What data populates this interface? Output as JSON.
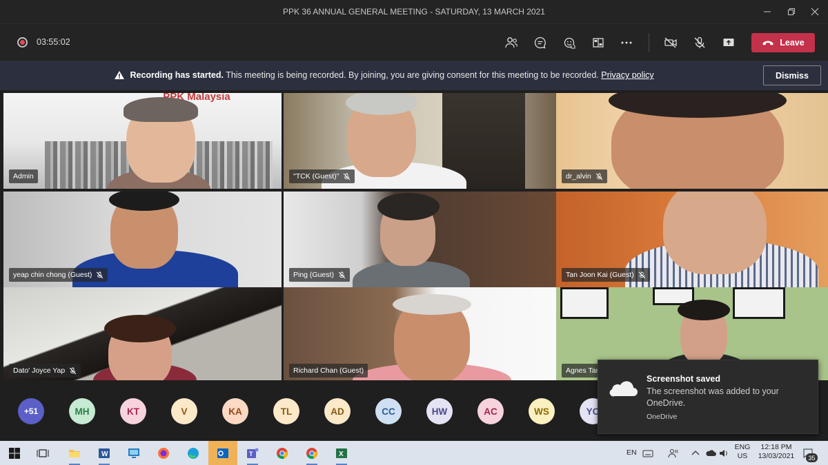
{
  "window": {
    "title": "PPK 36 ANNUAL GENERAL MEETING - SATURDAY, 13 MARCH 2021"
  },
  "toolbar": {
    "timer": "03:55:02",
    "leave_label": "Leave"
  },
  "banner": {
    "bold": "Recording has started.",
    "text": "This meeting is being recorded. By joining, you are giving consent for this meeting to be recorded.",
    "link": "Privacy policy",
    "dismiss_label": "Dismiss"
  },
  "tiles": [
    {
      "name": "Admin"
    },
    {
      "name": "\"TCK (Guest)\""
    },
    {
      "name": "dr_alvin"
    },
    {
      "name": "yeap chin chong (Guest)"
    },
    {
      "name": "Ping (Guest)"
    },
    {
      "name": "Tan Joon Kai (Guest)"
    },
    {
      "name": "Dato' Joyce Yap"
    },
    {
      "name": "Richard Chan (Guest)"
    },
    {
      "name": "Agnes Tan"
    }
  ],
  "tile1_logo": "PPK Malaysia",
  "participants": {
    "overflow_count": "+51",
    "overflow_color": "#5b5fc7",
    "avatars": [
      {
        "initials": "MH",
        "bg": "#c6ead2",
        "fg": "#2e7d4a"
      },
      {
        "initials": "KT",
        "bg": "#f6d3dd",
        "fg": "#a4264a"
      },
      {
        "initials": "V",
        "bg": "#fbe9c9",
        "fg": "#8a5a12"
      },
      {
        "initials": "KA",
        "bg": "#fbd9c4",
        "fg": "#9a4417"
      },
      {
        "initials": "TL",
        "bg": "#fbe9c9",
        "fg": "#8a5a12"
      },
      {
        "initials": "AD",
        "bg": "#fbe9c9",
        "fg": "#8a5a12"
      },
      {
        "initials": "CC",
        "bg": "#cfe0f3",
        "fg": "#2d5b9a"
      },
      {
        "initials": "HW",
        "bg": "#e3e3f3",
        "fg": "#4a4a8a"
      },
      {
        "initials": "AC",
        "bg": "#f6d3dd",
        "fg": "#a4264a"
      },
      {
        "initials": "WS",
        "bg": "#fbf0c0",
        "fg": "#8a6a00"
      },
      {
        "initials": "YC",
        "bg": "#e3e3f3",
        "fg": "#4a4a8a"
      }
    ]
  },
  "toast": {
    "title": "Screenshot saved",
    "body": "The screenshot was added to your OneDrive.",
    "app": "OneDrive"
  },
  "taskbar": {
    "input_lang": "EN",
    "lang_top": "ENG",
    "lang_bottom": "US",
    "time": "12:18 PM",
    "date": "13/03/2021",
    "notif_count": "35"
  }
}
